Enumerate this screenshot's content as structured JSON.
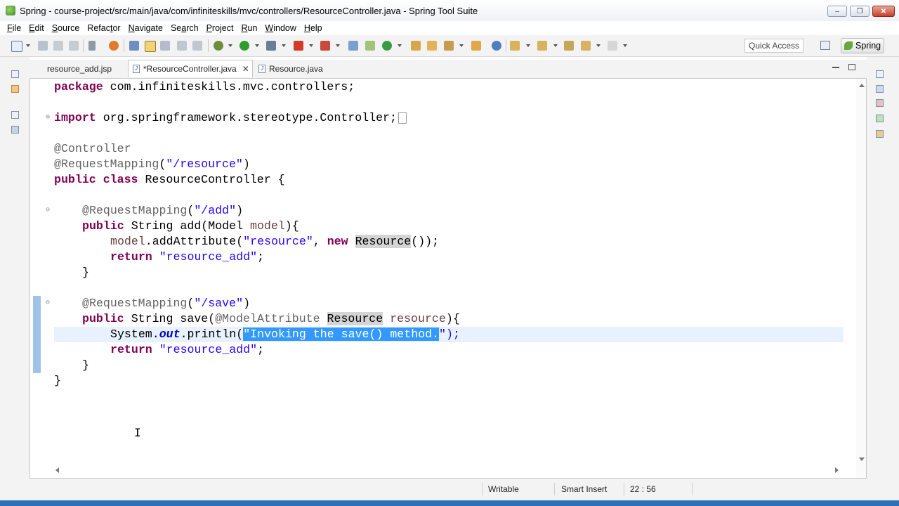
{
  "window": {
    "title": "Spring - course-project/src/main/java/com/infiniteskills/mvc/controllers/ResourceController.java - Spring Tool Suite",
    "minimize": "–",
    "maximize": "❐",
    "close": "✕"
  },
  "menu": [
    {
      "label": "File",
      "mnemonic": "F",
      "rest": "ile"
    },
    {
      "label": "Edit",
      "mnemonic": "E",
      "rest": "dit"
    },
    {
      "label": "Source",
      "mnemonic": "S",
      "rest": "ource"
    },
    {
      "label": "Refactor",
      "pre": "Refac",
      "mnemonic": "t",
      "rest": "or"
    },
    {
      "label": "Navigate",
      "mnemonic": "N",
      "rest": "avigate"
    },
    {
      "label": "Search",
      "pre": "Se",
      "mnemonic": "a",
      "rest": "rch"
    },
    {
      "label": "Project",
      "mnemonic": "P",
      "rest": "roject"
    },
    {
      "label": "Run",
      "mnemonic": "R",
      "rest": "un"
    },
    {
      "label": "Window",
      "mnemonic": "W",
      "rest": "indow"
    },
    {
      "label": "Help",
      "mnemonic": "H",
      "rest": "elp"
    }
  ],
  "toolbar": {
    "quick_access_placeholder": "Quick Access",
    "perspective": "Spring"
  },
  "tabs": [
    {
      "label": "resource_add.jsp",
      "active": false
    },
    {
      "label": "*ResourceController.java",
      "active": true
    },
    {
      "label": "Resource.java",
      "active": false
    }
  ],
  "tab_close_glyph": "✕",
  "code": {
    "l1_kw": "package",
    "l1_rest": " com.infiniteskills.mvc.controllers;",
    "l2_kw": "import",
    "l2_rest": " org.springframework.stereotype.Controller;",
    "l3_ann": "@Controller",
    "l4_ann": "@RequestMapping",
    "l4_open": "(",
    "l4_str": "\"/resource\"",
    "l4_close": ")",
    "l5_kw": "public class",
    "l5_rest": " ResourceController {",
    "l6_ann": "@RequestMapping",
    "l6_open": "(",
    "l6_str": "\"/add\"",
    "l6_close": ")",
    "l7_kw": "public",
    "l7_mid": " String add(Model ",
    "l7_var": "model",
    "l7_end": "){",
    "l8_var": "model",
    "l8_mid": ".addAttribute(",
    "l8_str": "\"resource\"",
    "l8_comma": ", ",
    "l8_kw": "new",
    "l8_sp": " ",
    "l8_occ": "Resource",
    "l8_end": "());",
    "l9_kw": "return",
    "l9_sp": " ",
    "l9_str": "\"resource_add\"",
    "l9_end": ";",
    "l10": "}",
    "l11_ann": "@RequestMapping",
    "l11_open": "(",
    "l11_str": "\"/save\"",
    "l11_close": ")",
    "l12_kw": "public",
    "l12_mid": " String save(",
    "l12_ann": "@ModelAttribute",
    "l12_sp": " ",
    "l12_occ": "Resource",
    "l12_sp2": " ",
    "l12_var": "resource",
    "l12_end": "){",
    "l13_a": "System.",
    "l13_fld": "out",
    "l13_b": ".println(",
    "l13_sel": "\"Invoking the save() method.",
    "l13_end": "\");",
    "l14_kw": "return",
    "l14_sp": " ",
    "l14_str": "\"resource_add\"",
    "l14_end": ";",
    "l15": "}",
    "l16": "}"
  },
  "status": {
    "writable": "Writable",
    "insert_mode": "Smart Insert",
    "position": "22 : 56"
  },
  "colors": {
    "keyword": "#7f0055",
    "string": "#2a00ff",
    "annotation": "#646464",
    "selection": "#3399ff",
    "current_line": "#e8f2fe",
    "change_bar": "#9ec3e6"
  },
  "icons": [
    "new-icon",
    "save-icon",
    "save-all-icon",
    "print-icon",
    "debug-icon",
    "run-icon",
    "external-tools-icon",
    "stop-icon",
    "search-icon",
    "back-icon",
    "forward-icon",
    "open-perspective-icon",
    "spring-leaf-icon",
    "restore-icon",
    "maximize-icon"
  ]
}
